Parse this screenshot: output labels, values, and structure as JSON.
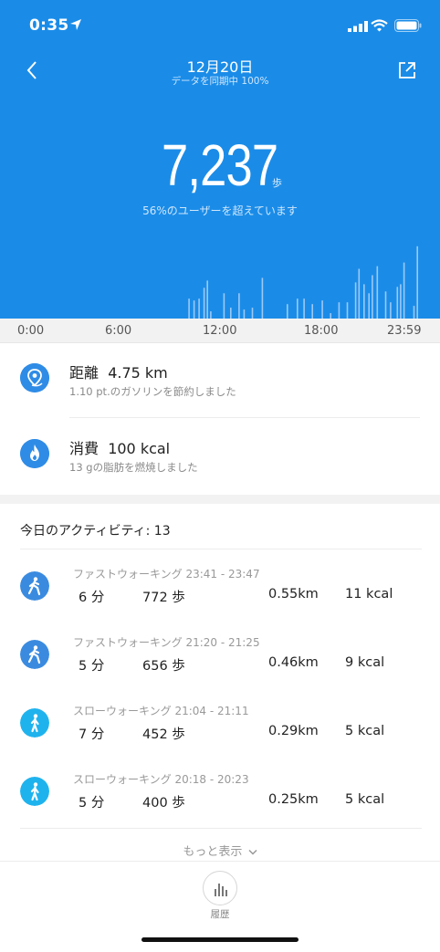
{
  "status_bar": {
    "time": "0:35"
  },
  "header": {
    "date": "12月20日",
    "sync": "データを同期中 100%"
  },
  "summary": {
    "steps": "7,237",
    "steps_unit": "歩",
    "percentile": "56%のユーザーを超えています"
  },
  "activity_chart": {
    "type": "bar",
    "description_axis": "hourly steps over day",
    "x_range": [
      "0:00",
      "23:59"
    ],
    "ticks": [
      "0:00",
      "6:00",
      "12:00",
      "18:00",
      "23:59"
    ],
    "bars": [
      {
        "t": 10.1,
        "v": 0.22
      },
      {
        "t": 10.4,
        "v": 0.2
      },
      {
        "t": 10.7,
        "v": 0.22
      },
      {
        "t": 11.0,
        "v": 0.34
      },
      {
        "t": 11.2,
        "v": 0.42
      },
      {
        "t": 11.4,
        "v": 0.08
      },
      {
        "t": 12.2,
        "v": 0.28
      },
      {
        "t": 12.6,
        "v": 0.12
      },
      {
        "t": 13.1,
        "v": 0.28
      },
      {
        "t": 13.4,
        "v": 0.1
      },
      {
        "t": 13.9,
        "v": 0.12
      },
      {
        "t": 14.5,
        "v": 0.45
      },
      {
        "t": 16.0,
        "v": 0.16
      },
      {
        "t": 16.6,
        "v": 0.22
      },
      {
        "t": 17.0,
        "v": 0.22
      },
      {
        "t": 17.5,
        "v": 0.16
      },
      {
        "t": 18.1,
        "v": 0.2
      },
      {
        "t": 18.6,
        "v": 0.06
      },
      {
        "t": 19.1,
        "v": 0.18
      },
      {
        "t": 19.6,
        "v": 0.18
      },
      {
        "t": 20.1,
        "v": 0.4
      },
      {
        "t": 20.3,
        "v": 0.55
      },
      {
        "t": 20.6,
        "v": 0.38
      },
      {
        "t": 20.9,
        "v": 0.28
      },
      {
        "t": 21.1,
        "v": 0.48
      },
      {
        "t": 21.4,
        "v": 0.58
      },
      {
        "t": 21.9,
        "v": 0.3
      },
      {
        "t": 22.2,
        "v": 0.18
      },
      {
        "t": 22.6,
        "v": 0.35
      },
      {
        "t": 22.8,
        "v": 0.38
      },
      {
        "t": 23.0,
        "v": 0.62
      },
      {
        "t": 23.6,
        "v": 0.14
      },
      {
        "t": 23.8,
        "v": 0.8
      }
    ],
    "bar_color": "#9cc9f4"
  },
  "distance": {
    "label": "距離",
    "value": "4.75 km",
    "sub": "1.10 pt.のガソリンを節約しました",
    "icon": "location-pin-icon"
  },
  "calories": {
    "label": "消費",
    "value": "100 kcal",
    "sub": "13 gの脂肪を燃焼しました",
    "icon": "flame-icon"
  },
  "activities": {
    "header": "今日のアクティビティ: 13",
    "items": [
      {
        "title": "ファストウォーキング 23:41 - 23:47",
        "duration": "6 分",
        "steps": "772 歩",
        "distance": "0.55km",
        "kcal": "11 kcal",
        "color": "#3a8be0",
        "icon": "fast-walk-icon"
      },
      {
        "title": "ファストウォーキング 21:20 - 21:25",
        "duration": "5 分",
        "steps": "656 歩",
        "distance": "0.46km",
        "kcal": "9 kcal",
        "color": "#3a8be0",
        "icon": "fast-walk-icon"
      },
      {
        "title": "スローウォーキング 21:04 - 21:11",
        "duration": "7 分",
        "steps": "452 歩",
        "distance": "0.29km",
        "kcal": "5 kcal",
        "color": "#1fb3ee",
        "icon": "slow-walk-icon"
      },
      {
        "title": "スローウォーキング 20:18 - 20:23",
        "duration": "5 分",
        "steps": "400 歩",
        "distance": "0.25km",
        "kcal": "5 kcal",
        "color": "#1fb3ee",
        "icon": "slow-walk-icon"
      }
    ],
    "more": "もっと表示"
  },
  "tabbar": {
    "history_label": "履歴"
  },
  "colors": {
    "header_blue": "#1a8ce8",
    "accent_blue": "#2f8ce6",
    "slow_walk": "#1fb3ee"
  }
}
